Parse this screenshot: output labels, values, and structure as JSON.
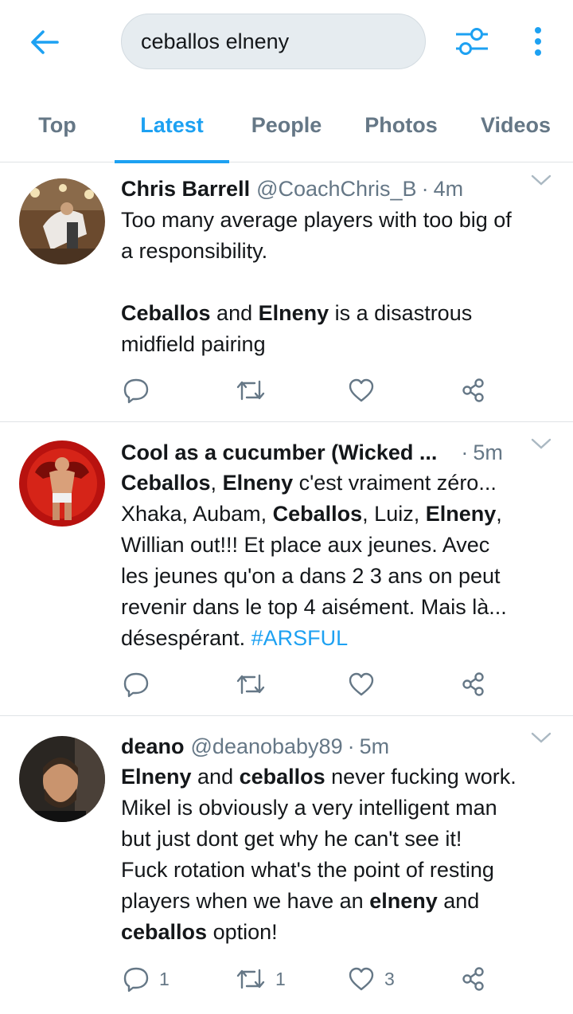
{
  "search": {
    "query": "ceballos elneny"
  },
  "tabs": [
    {
      "label": "Top"
    },
    {
      "label": "Latest"
    },
    {
      "label": "People"
    },
    {
      "label": "Photos"
    },
    {
      "label": "Videos"
    }
  ],
  "active_tab": "Latest",
  "colors": {
    "accent": "#1da1f2",
    "muted": "#657786",
    "text": "#14171a",
    "search_bg": "#e6ecf0"
  },
  "icons": [
    "back-arrow-icon",
    "filter-sliders-icon",
    "more-vertical-icon",
    "chevron-down-icon",
    "reply-icon",
    "retweet-icon",
    "like-icon",
    "share-icon"
  ],
  "tweets": [
    {
      "name": "Chris Barrell",
      "handle": "@CoachChris_B",
      "dot": "·",
      "time": "4m",
      "lines": {
        "l1": "Too many average players with too big of",
        "l2": "a responsibility.",
        "l3a": "Ceballos",
        "l3b": " and ",
        "l3c": "Elneny",
        "l3d": " is a disastrous",
        "l4": "midfield pairing"
      },
      "counts": {
        "replies": "",
        "retweets": "",
        "likes": ""
      }
    },
    {
      "name": "Cool as a cucumber (Wicked ...",
      "handle": "",
      "dot": "·",
      "time": "5m",
      "lines": {
        "l1a": "Ceballos",
        "l1b": ", ",
        "l1c": "Elneny",
        "l1d": " c'est vraiment zéro...",
        "l2a": "Xhaka, Aubam, ",
        "l2b": "Ceballos",
        "l2c": ", Luiz, ",
        "l2d": "Elneny",
        "l2e": ",",
        "l3": "Willian out!!! Et place aux jeunes. Avec",
        "l4": "les jeunes qu'on a dans 2 3 ans on peut",
        "l5": "revenir dans le top 4 aisément. Mais là...",
        "l6a": "désespérant. ",
        "l6b": "#ARSFUL"
      },
      "counts": {
        "replies": "",
        "retweets": "",
        "likes": ""
      }
    },
    {
      "name": "deano",
      "handle": "@deanobaby89",
      "dot": "·",
      "time": "5m",
      "lines": {
        "l1a": "Elneny",
        "l1b": " and ",
        "l1c": "ceballos",
        "l1d": " never fucking work.",
        "l2": "Mikel is obviously a very intelligent man",
        "l3": "but just dont get why he can't see it!",
        "l4": "Fuck rotation what's the point of resting",
        "l5a": "players when we have an ",
        "l5b": "elneny",
        "l5c": " and",
        "l6a": "ceballos",
        "l6b": " option!"
      },
      "counts": {
        "replies": "1",
        "retweets": "1",
        "likes": "3"
      }
    }
  ]
}
